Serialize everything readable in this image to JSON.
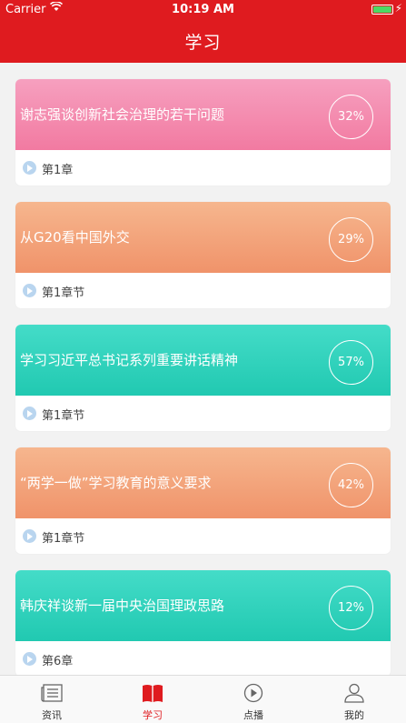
{
  "status_bar": {
    "carrier": "Carrier",
    "time": "10:19 AM"
  },
  "header": {
    "title": "学习"
  },
  "courses": [
    {
      "title": "谢志强谈创新社会治理的若干问题",
      "progress": "32%",
      "chapter": "第1章",
      "gradient": [
        "#f6a0bf",
        "#f27aa1"
      ]
    },
    {
      "title": "从G20看中国外交",
      "progress": "29%",
      "chapter": "第1章节",
      "gradient": [
        "#f6b68e",
        "#f0936a"
      ]
    },
    {
      "title": "学习习近平总书记系列重要讲话精神",
      "progress": "57%",
      "chapter": "第1章节",
      "gradient": [
        "#44dcc8",
        "#21c9b1"
      ]
    },
    {
      "title": "“两学一做”学习教育的意义要求",
      "progress": "42%",
      "chapter": "第1章节",
      "gradient": [
        "#f6b68e",
        "#f0936a"
      ]
    },
    {
      "title": "韩庆祥谈新一届中央治国理政思路",
      "progress": "12%",
      "chapter": "第6章",
      "gradient": [
        "#44dcc8",
        "#21c9b1"
      ]
    }
  ],
  "tabbar": {
    "items": [
      {
        "label": "资讯",
        "icon": "news-icon"
      },
      {
        "label": "学习",
        "icon": "book-icon"
      },
      {
        "label": "点播",
        "icon": "play-icon"
      },
      {
        "label": "我的",
        "icon": "profile-icon"
      }
    ],
    "active_color": "#df1b1f"
  }
}
